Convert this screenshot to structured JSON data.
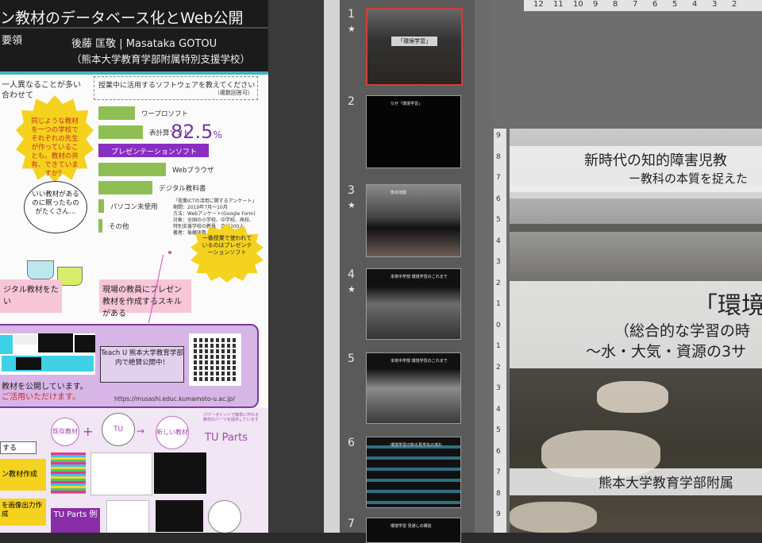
{
  "poster": {
    "title": "ン教材のデータベース化とWeb公開",
    "subtitle": "要領",
    "author": "後藤 匡敬 | Masataka GOTOU",
    "affiliation": "（熊本大学教育学部附属特別支援学校）",
    "left_note_1": "一人異なることが多い",
    "left_note_2": "合わせて",
    "survey_header": "授業中に活用するソフトウェアを教えてください",
    "survey_note": "（複数回答可）",
    "bars": [
      {
        "label": "ワープロソフト",
        "value": 0.27
      },
      {
        "label": "表計算ソフト",
        "value": 0.33
      },
      {
        "label": "プレゼンテーションソフト",
        "value": 0.82
      },
      {
        "label": "Webブラウザ",
        "value": 0.5
      },
      {
        "label": "デジタル教科書",
        "value": 0.4
      },
      {
        "label": "パソコン未使用",
        "value": 0.04
      },
      {
        "label": "その他",
        "value": 0.03
      }
    ],
    "highlight_percent": "82.5",
    "percent_unit": "%",
    "bubble_question": "同じような教材を一つの学校でそれぞれの先生が作っていることも。教材の共有、できていますか？",
    "thought_bubble": "いい教材があるのに眠ったものがたくさん…",
    "survey_info_1": "「授業ICTの活用に関するアンケート」",
    "survey_info_2": "期間：2019年7月～10月",
    "survey_info_3": "方法：Webアンケート(Google Form)",
    "survey_info_4": "対象：全国の小学校、中学校、高校、",
    "survey_info_5": "特別支援学校の教員　合計200人",
    "survey_info_6": "著者：後藤匡敬",
    "burst_right": "一番授業で使われているのはプレゼンテーションソフト",
    "pink_left": "ジタル教材をたい",
    "pink_right": "現場の教員にプレゼン教材を作成するスキルがある",
    "publish_line_1": "教材を公開しています。",
    "publish_line_2": "ご活用いただけます。",
    "teachu_box": "Teach U 熊本大学教育学部内で絶賛公開中！",
    "url": "https://musashi.educ.kumamoto-u.ac.jp/",
    "flow_left": "既存教材",
    "flow_mid": "TU",
    "flow_right": "新しい教材",
    "tu_parts": "TU Parts",
    "tu_parts_note": "パワーポイントで簡単に作れる教材のパーツを提供しています",
    "side_label_1": "する",
    "side_label_2": "ン教材作成",
    "side_label_3": "を画像出力作成",
    "tu_parts_example": "TU Parts 例"
  },
  "slides_panel": {
    "slides": [
      {
        "number": "1",
        "starred": true,
        "selected": true,
        "text": "「環境学習」"
      },
      {
        "number": "2",
        "starred": false,
        "selected": false,
        "text": "なぜ「環境学習」"
      },
      {
        "number": "3",
        "starred": true,
        "selected": false,
        "text": "熊本地震"
      },
      {
        "number": "4",
        "starred": true,
        "selected": false,
        "text": "本校中学部 環境学習のこれまで"
      },
      {
        "number": "5",
        "starred": false,
        "selected": false,
        "text": "本校中学部 環境学習のこれまで"
      },
      {
        "number": "6",
        "starred": false,
        "selected": false,
        "text": "環境学習の知る見学先の流れ"
      },
      {
        "number": "7",
        "starred": false,
        "selected": false,
        "text": "環境学習 見通しの構造"
      }
    ],
    "star_glyph": "★"
  },
  "ruler": {
    "h_ticks": [
      "12",
      "11",
      "10",
      "9",
      "8",
      "7",
      "6",
      "5",
      "4",
      "3",
      "2"
    ],
    "v_ticks": [
      "9",
      "8",
      "7",
      "6",
      "5",
      "4",
      "3",
      "2",
      "1",
      "0",
      "1",
      "2",
      "3",
      "4",
      "5",
      "6",
      "7",
      "8",
      "9"
    ]
  },
  "slide": {
    "line_1": "新時代の知的障害児教",
    "line_2": "ー教科の本質を捉えた",
    "title": "「環境",
    "subtitle_1": "（総合的な学習の時",
    "subtitle_2": "～水・大気・資源の3サ",
    "footer": "熊本大学教育学部附属"
  }
}
